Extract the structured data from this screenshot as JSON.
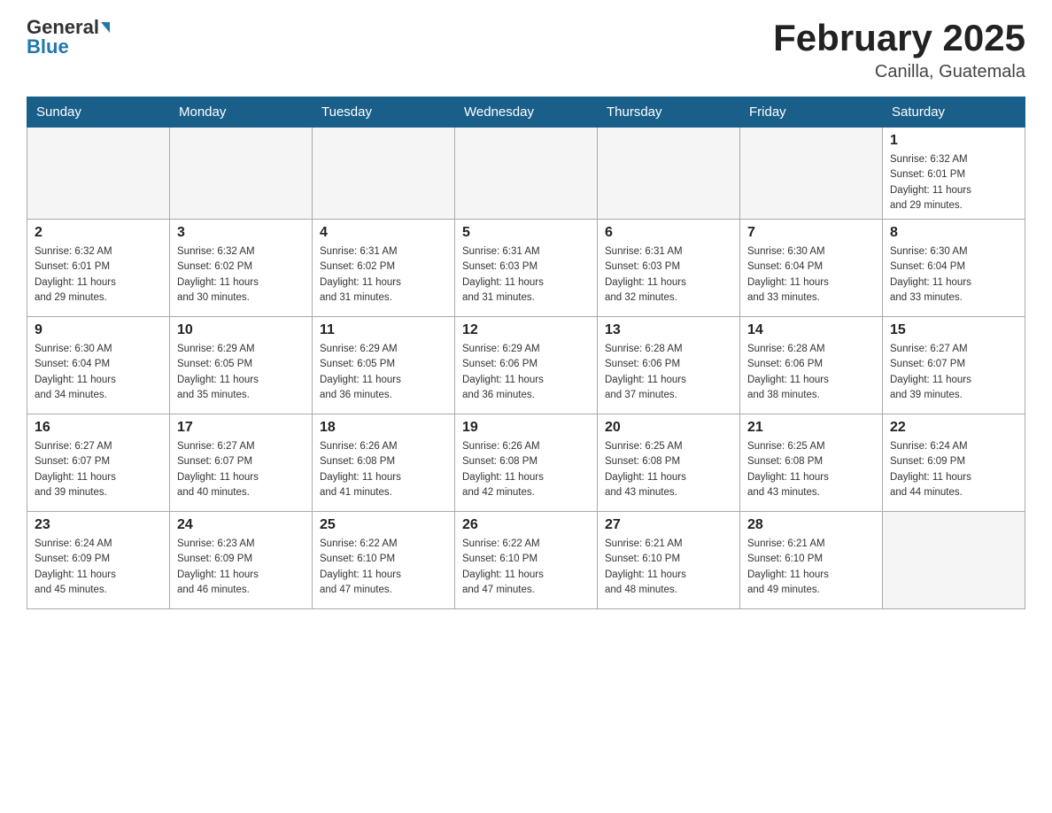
{
  "header": {
    "logo_general": "General",
    "logo_blue": "Blue",
    "title": "February 2025",
    "subtitle": "Canilla, Guatemala"
  },
  "weekdays": [
    "Sunday",
    "Monday",
    "Tuesday",
    "Wednesday",
    "Thursday",
    "Friday",
    "Saturday"
  ],
  "weeks": [
    [
      {
        "day": "",
        "info": ""
      },
      {
        "day": "",
        "info": ""
      },
      {
        "day": "",
        "info": ""
      },
      {
        "day": "",
        "info": ""
      },
      {
        "day": "",
        "info": ""
      },
      {
        "day": "",
        "info": ""
      },
      {
        "day": "1",
        "info": "Sunrise: 6:32 AM\nSunset: 6:01 PM\nDaylight: 11 hours\nand 29 minutes."
      }
    ],
    [
      {
        "day": "2",
        "info": "Sunrise: 6:32 AM\nSunset: 6:01 PM\nDaylight: 11 hours\nand 29 minutes."
      },
      {
        "day": "3",
        "info": "Sunrise: 6:32 AM\nSunset: 6:02 PM\nDaylight: 11 hours\nand 30 minutes."
      },
      {
        "day": "4",
        "info": "Sunrise: 6:31 AM\nSunset: 6:02 PM\nDaylight: 11 hours\nand 31 minutes."
      },
      {
        "day": "5",
        "info": "Sunrise: 6:31 AM\nSunset: 6:03 PM\nDaylight: 11 hours\nand 31 minutes."
      },
      {
        "day": "6",
        "info": "Sunrise: 6:31 AM\nSunset: 6:03 PM\nDaylight: 11 hours\nand 32 minutes."
      },
      {
        "day": "7",
        "info": "Sunrise: 6:30 AM\nSunset: 6:04 PM\nDaylight: 11 hours\nand 33 minutes."
      },
      {
        "day": "8",
        "info": "Sunrise: 6:30 AM\nSunset: 6:04 PM\nDaylight: 11 hours\nand 33 minutes."
      }
    ],
    [
      {
        "day": "9",
        "info": "Sunrise: 6:30 AM\nSunset: 6:04 PM\nDaylight: 11 hours\nand 34 minutes."
      },
      {
        "day": "10",
        "info": "Sunrise: 6:29 AM\nSunset: 6:05 PM\nDaylight: 11 hours\nand 35 minutes."
      },
      {
        "day": "11",
        "info": "Sunrise: 6:29 AM\nSunset: 6:05 PM\nDaylight: 11 hours\nand 36 minutes."
      },
      {
        "day": "12",
        "info": "Sunrise: 6:29 AM\nSunset: 6:06 PM\nDaylight: 11 hours\nand 36 minutes."
      },
      {
        "day": "13",
        "info": "Sunrise: 6:28 AM\nSunset: 6:06 PM\nDaylight: 11 hours\nand 37 minutes."
      },
      {
        "day": "14",
        "info": "Sunrise: 6:28 AM\nSunset: 6:06 PM\nDaylight: 11 hours\nand 38 minutes."
      },
      {
        "day": "15",
        "info": "Sunrise: 6:27 AM\nSunset: 6:07 PM\nDaylight: 11 hours\nand 39 minutes."
      }
    ],
    [
      {
        "day": "16",
        "info": "Sunrise: 6:27 AM\nSunset: 6:07 PM\nDaylight: 11 hours\nand 39 minutes."
      },
      {
        "day": "17",
        "info": "Sunrise: 6:27 AM\nSunset: 6:07 PM\nDaylight: 11 hours\nand 40 minutes."
      },
      {
        "day": "18",
        "info": "Sunrise: 6:26 AM\nSunset: 6:08 PM\nDaylight: 11 hours\nand 41 minutes."
      },
      {
        "day": "19",
        "info": "Sunrise: 6:26 AM\nSunset: 6:08 PM\nDaylight: 11 hours\nand 42 minutes."
      },
      {
        "day": "20",
        "info": "Sunrise: 6:25 AM\nSunset: 6:08 PM\nDaylight: 11 hours\nand 43 minutes."
      },
      {
        "day": "21",
        "info": "Sunrise: 6:25 AM\nSunset: 6:08 PM\nDaylight: 11 hours\nand 43 minutes."
      },
      {
        "day": "22",
        "info": "Sunrise: 6:24 AM\nSunset: 6:09 PM\nDaylight: 11 hours\nand 44 minutes."
      }
    ],
    [
      {
        "day": "23",
        "info": "Sunrise: 6:24 AM\nSunset: 6:09 PM\nDaylight: 11 hours\nand 45 minutes."
      },
      {
        "day": "24",
        "info": "Sunrise: 6:23 AM\nSunset: 6:09 PM\nDaylight: 11 hours\nand 46 minutes."
      },
      {
        "day": "25",
        "info": "Sunrise: 6:22 AM\nSunset: 6:10 PM\nDaylight: 11 hours\nand 47 minutes."
      },
      {
        "day": "26",
        "info": "Sunrise: 6:22 AM\nSunset: 6:10 PM\nDaylight: 11 hours\nand 47 minutes."
      },
      {
        "day": "27",
        "info": "Sunrise: 6:21 AM\nSunset: 6:10 PM\nDaylight: 11 hours\nand 48 minutes."
      },
      {
        "day": "28",
        "info": "Sunrise: 6:21 AM\nSunset: 6:10 PM\nDaylight: 11 hours\nand 49 minutes."
      },
      {
        "day": "",
        "info": ""
      }
    ]
  ]
}
